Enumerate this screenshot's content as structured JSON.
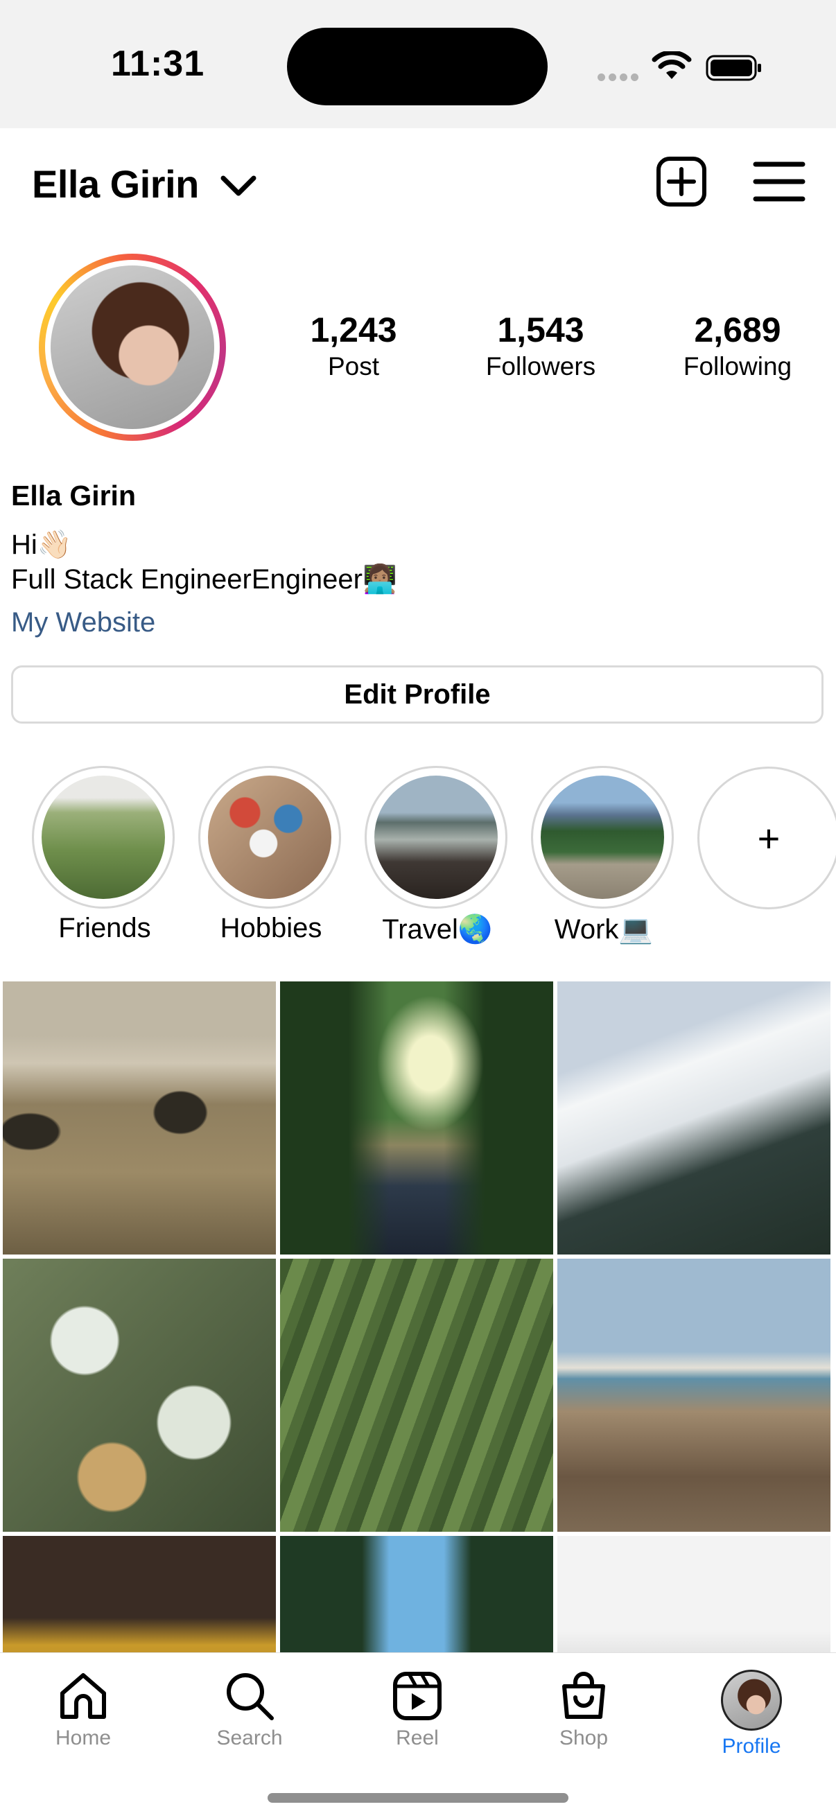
{
  "status_bar": {
    "time": "11:31"
  },
  "header": {
    "username": "Ella Girin"
  },
  "stats": [
    {
      "value": "1,243",
      "label": "Post"
    },
    {
      "value": "1,543",
      "label": "Followers"
    },
    {
      "value": "2,689",
      "label": "Following"
    }
  ],
  "bio": {
    "name": "Ella Girin",
    "line1": "Hi👋🏻",
    "line2": "Full Stack EngineerEngineer👩🏽‍💻",
    "website": "My Website"
  },
  "edit_profile_label": "Edit Profile",
  "highlights": [
    {
      "label": "Friends"
    },
    {
      "label": "Hobbies"
    },
    {
      "label": "Travel🌏"
    },
    {
      "label": "Work💻"
    }
  ],
  "add_highlight_label": "+",
  "tabs": [
    {
      "label": "Home"
    },
    {
      "label": "Search"
    },
    {
      "label": "Reel"
    },
    {
      "label": "Shop"
    },
    {
      "label": "Profile"
    }
  ],
  "colors": {
    "accent": "#1877f2",
    "link": "#385b86",
    "tab_inactive": "#8e8e8e"
  }
}
